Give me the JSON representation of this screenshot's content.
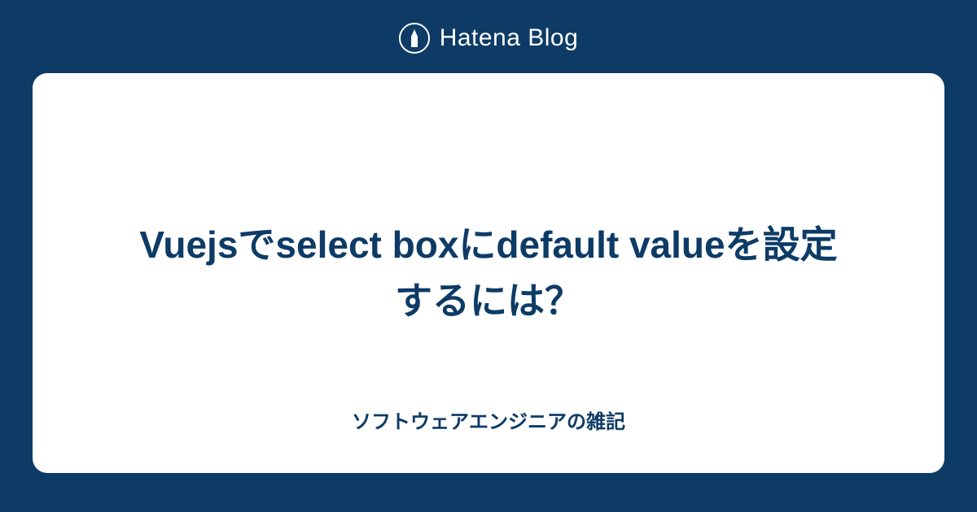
{
  "header": {
    "brand": "Hatena Blog"
  },
  "card": {
    "title": "Vuejsでselect boxにdefault valueを設定するには？",
    "subtitle": "ソフトウェアエンジニアの雑記"
  }
}
